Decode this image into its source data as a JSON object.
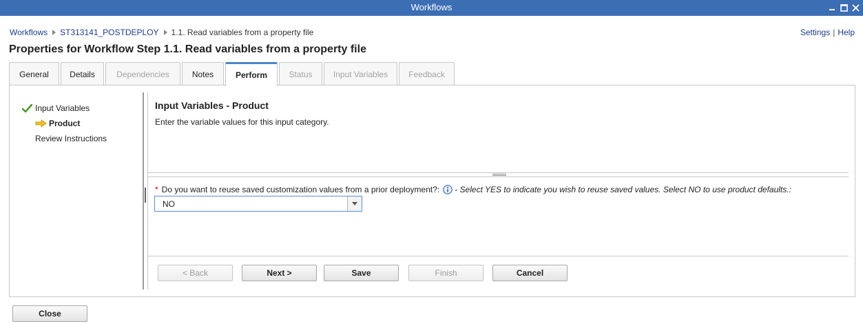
{
  "window": {
    "title": "Workflows",
    "controls": [
      "minimize-icon",
      "maximize-icon",
      "close-icon"
    ]
  },
  "breadcrumb": {
    "root": "Workflows",
    "workflow": "ST313141_POSTDEPLOY",
    "current": "1.1. Read variables from a property file"
  },
  "top_links": {
    "settings": "Settings",
    "separator": "|",
    "help": "Help"
  },
  "page_title": "Properties for Workflow Step 1.1. Read variables from a property file",
  "tabs": [
    {
      "label": "General",
      "state": "enabled"
    },
    {
      "label": "Details",
      "state": "enabled"
    },
    {
      "label": "Dependencies",
      "state": "disabled"
    },
    {
      "label": "Notes",
      "state": "enabled"
    },
    {
      "label": "Perform",
      "state": "active"
    },
    {
      "label": "Status",
      "state": "disabled"
    },
    {
      "label": "Input Variables",
      "state": "disabled"
    },
    {
      "label": "Feedback",
      "state": "disabled"
    }
  ],
  "steps": [
    {
      "label": "Input Variables",
      "icon": "checkmark-icon"
    },
    {
      "label": "Product",
      "icon": "arrow-right-icon"
    },
    {
      "label": "Review Instructions",
      "icon": ""
    }
  ],
  "section": {
    "title": "Input Variables - Product",
    "description": "Enter the variable values for this input category."
  },
  "question": {
    "required_marker": "*",
    "label": "Do you want to reuse saved customization values from a prior deployment?:",
    "hint": "- Select YES to indicate you wish to reuse saved values. Select NO to use product defaults.:",
    "value": "NO"
  },
  "buttons": {
    "back": "< Back",
    "next": "Next >",
    "save": "Save",
    "finish": "Finish",
    "cancel": "Cancel",
    "close": "Close"
  },
  "colors": {
    "titlebar": "#3c6eb4",
    "link": "#1a3d8f",
    "active_tab_accent": "#4a86c8",
    "check": "#4a9a2a",
    "arrow": "#f0c419",
    "required": "#cc0000"
  }
}
